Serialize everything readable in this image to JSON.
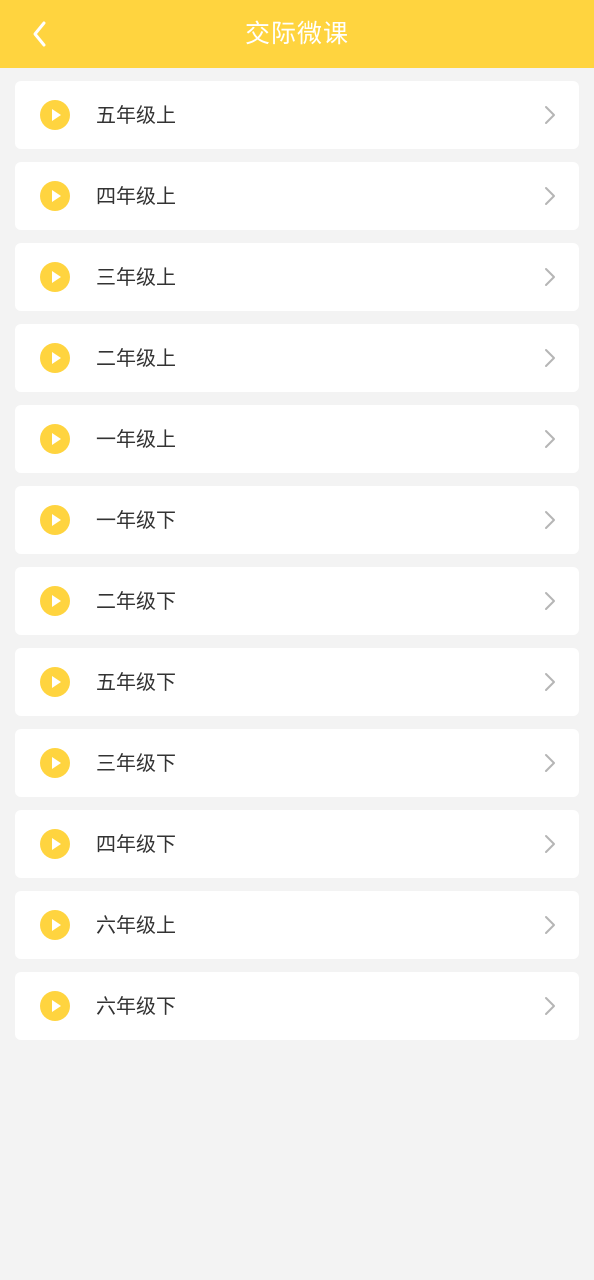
{
  "header": {
    "title": "交际微课",
    "back_icon": "chevron-left-icon",
    "background": "#ffd43f"
  },
  "list": {
    "items": [
      {
        "label": "五年级上",
        "icon": "play-circle-icon"
      },
      {
        "label": "四年级上",
        "icon": "play-circle-icon"
      },
      {
        "label": "三年级上",
        "icon": "play-circle-icon"
      },
      {
        "label": "二年级上",
        "icon": "play-circle-icon"
      },
      {
        "label": "一年级上",
        "icon": "play-circle-icon"
      },
      {
        "label": "一年级下",
        "icon": "play-circle-icon"
      },
      {
        "label": "二年级下",
        "icon": "play-circle-icon"
      },
      {
        "label": "五年级下",
        "icon": "play-circle-icon"
      },
      {
        "label": "三年级下",
        "icon": "play-circle-icon"
      },
      {
        "label": "四年级下",
        "icon": "play-circle-icon"
      },
      {
        "label": "六年级上",
        "icon": "play-circle-icon"
      },
      {
        "label": "六年级下",
        "icon": "play-circle-icon"
      }
    ]
  },
  "colors": {
    "accent": "#ffd43f",
    "page_background": "#f3f3f3",
    "card_background": "#ffffff",
    "text": "#333333",
    "chevron": "#b5b5b5"
  }
}
